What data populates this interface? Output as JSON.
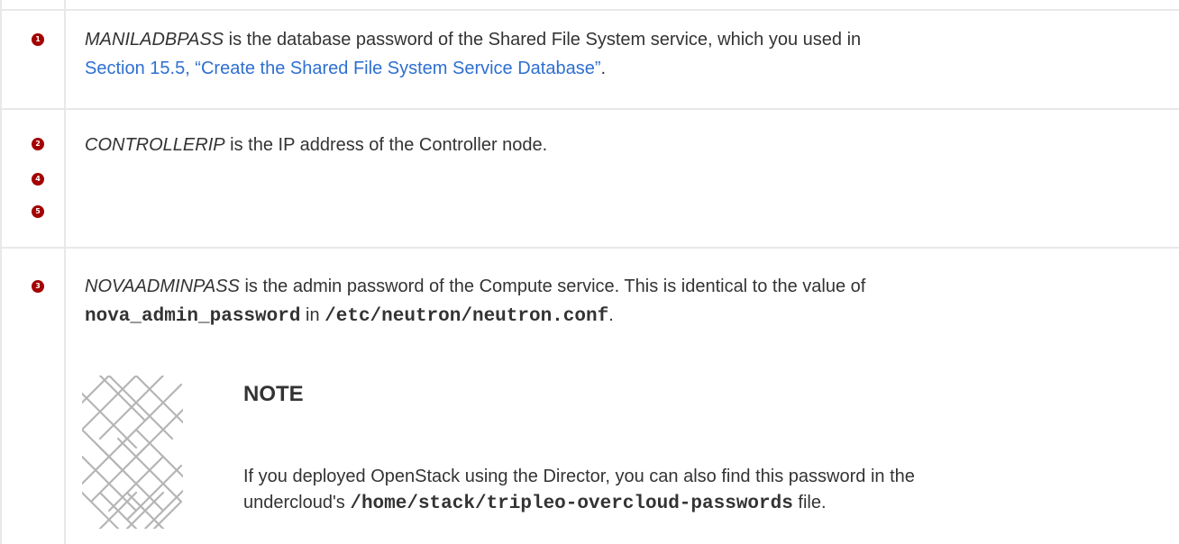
{
  "callouts": [
    {
      "numbers": [
        "1"
      ],
      "variable": "MANILADBPASS",
      "text": " is the database password of the Shared File System service, which you used in",
      "link": "Section 15.5, “Create the Shared File System Service Database”",
      "after_link": "."
    },
    {
      "numbers": [
        "2",
        "4",
        "5"
      ],
      "variable": "CONTROLLERIP",
      "text": " is the IP address of the Controller node."
    },
    {
      "numbers": [
        "3"
      ],
      "variable": "NOVAADMINPASS",
      "text": " is the admin password of the Compute service. This is identical to the value of",
      "code1": "nova_admin_password",
      "mid": " in ",
      "code2": "/etc/neutron/neutron.conf",
      "end": "."
    }
  ],
  "note": {
    "title": "NOTE",
    "line1": "If you deployed OpenStack using the Director, you can also find this password in the",
    "line2_prefix": "undercloud's ",
    "code": "/home/stack/tripleo-overcloud-passwords",
    "line2_suffix": " file."
  },
  "colors": {
    "badge": "#a30000",
    "link": "#2e6fd1",
    "border": "#e8e8e8",
    "text": "#333333"
  }
}
